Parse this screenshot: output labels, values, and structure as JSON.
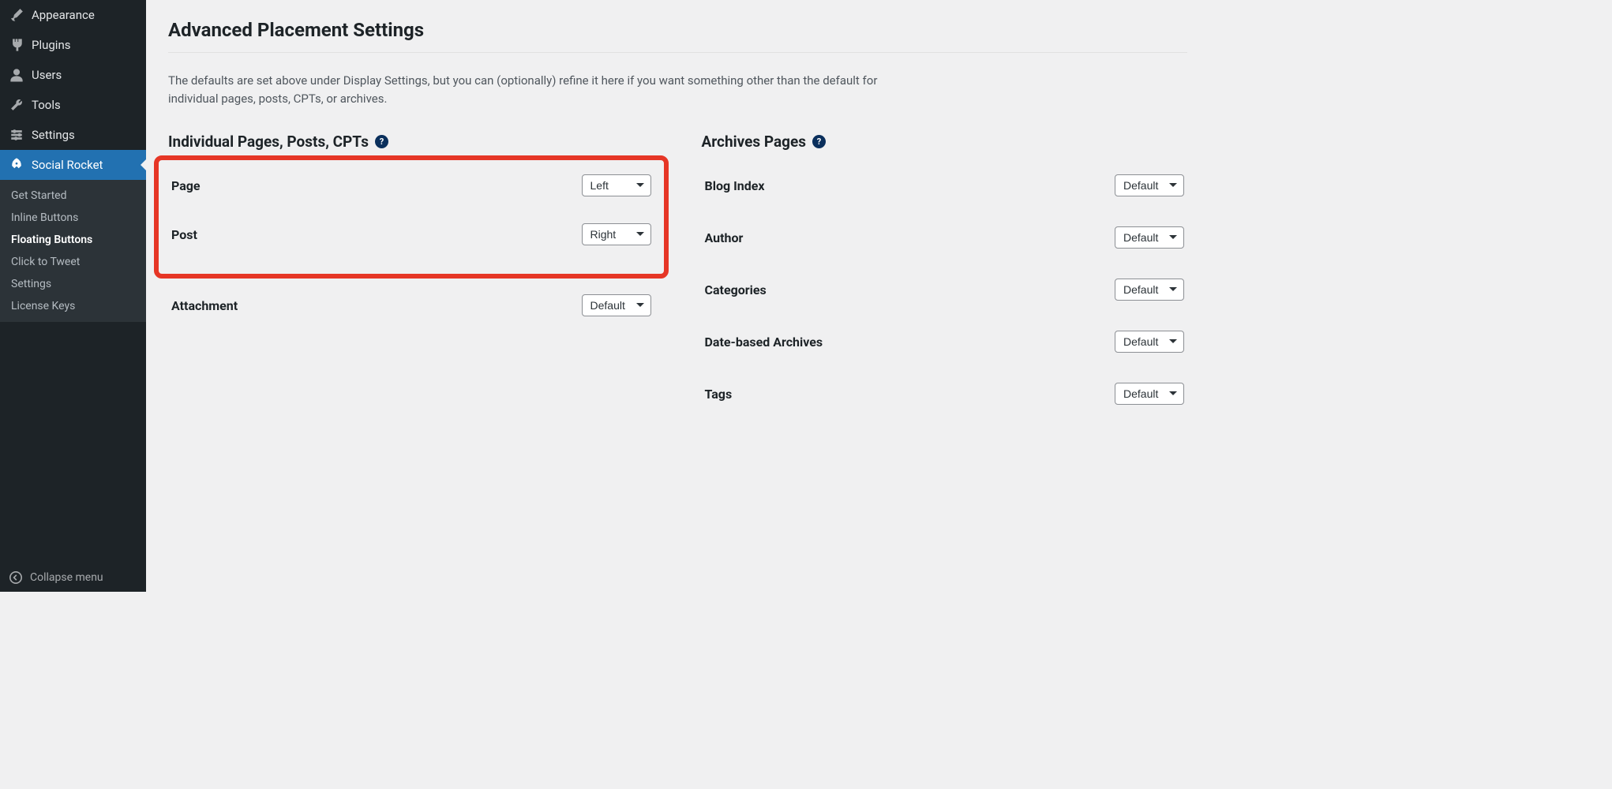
{
  "sidebar": {
    "items": [
      {
        "icon": "brush",
        "label": "Appearance"
      },
      {
        "icon": "plug",
        "label": "Plugins"
      },
      {
        "icon": "user",
        "label": "Users"
      },
      {
        "icon": "wrench",
        "label": "Tools"
      },
      {
        "icon": "sliders",
        "label": "Settings"
      },
      {
        "icon": "rocket",
        "label": "Social Rocket",
        "active": true
      }
    ],
    "submenu": [
      {
        "label": "Get Started"
      },
      {
        "label": "Inline Buttons"
      },
      {
        "label": "Floating Buttons",
        "current": true
      },
      {
        "label": "Click to Tweet"
      },
      {
        "label": "Settings"
      },
      {
        "label": "License Keys"
      }
    ],
    "collapse_label": "Collapse menu"
  },
  "page": {
    "title": "Advanced Placement Settings",
    "description": "The defaults are set above under Display Settings, but you can (optionally) refine it here if you want something other than the default for individual pages, posts, CPTs, or archives."
  },
  "sections": {
    "individual_title": "Individual Pages, Posts, CPTs",
    "archives_title": "Archives Pages",
    "individual": [
      {
        "label": "Page",
        "value": "Left",
        "highlight": true
      },
      {
        "label": "Post",
        "value": "Right",
        "highlight": true
      },
      {
        "label": "Attachment",
        "value": "Default"
      }
    ],
    "archives": [
      {
        "label": "Blog Index",
        "value": "Default"
      },
      {
        "label": "Author",
        "value": "Default"
      },
      {
        "label": "Categories",
        "value": "Default"
      },
      {
        "label": "Date-based Archives",
        "value": "Default"
      },
      {
        "label": "Tags",
        "value": "Default"
      }
    ]
  },
  "help_glyph": "?"
}
